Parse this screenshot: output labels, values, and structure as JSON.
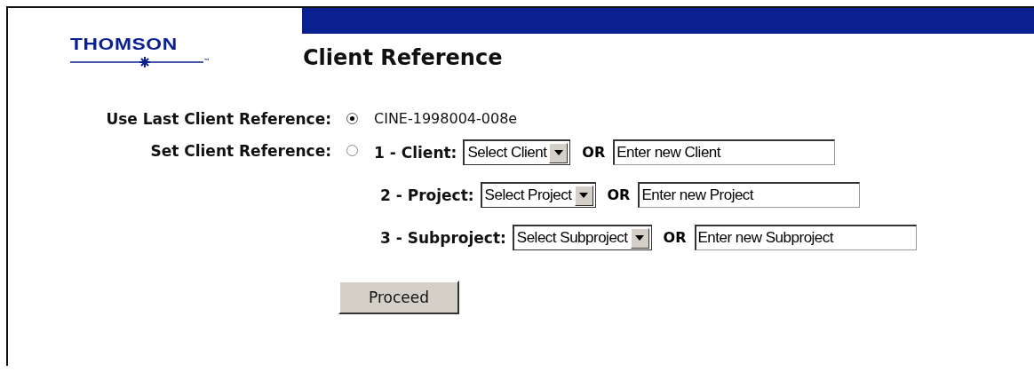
{
  "logo": {
    "text": "THOMSON",
    "tm": "™"
  },
  "title": "Client Reference",
  "options": [
    {
      "label": "Use Last Client Reference:",
      "selected": true,
      "kind": "value",
      "value": "CINE-1998004-008e"
    },
    {
      "label": "Set Client Reference:",
      "selected": false,
      "kind": "fields",
      "fields": [
        {
          "label": "1 - Client:",
          "select": "Select Client",
          "separator": "OR",
          "value": "Enter new Client"
        },
        {
          "label": "2 - Project:",
          "select": "Select Project",
          "separator": "OR",
          "value": "Enter new Project"
        },
        {
          "label": "3 - Subproject:",
          "select": "Select Subproject",
          "separator": "OR",
          "value": "Enter new Subproject"
        }
      ]
    }
  ],
  "button": "Proceed"
}
